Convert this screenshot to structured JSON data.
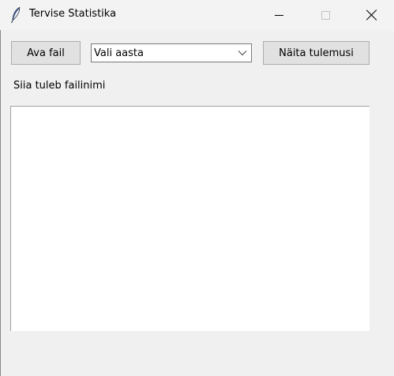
{
  "window": {
    "title": "Tervise Statistika",
    "app_icon": "feather-icon",
    "controls": [
      "minimize-icon",
      "maximize-icon",
      "close-icon"
    ]
  },
  "toolbar": {
    "open_file_label": "Ava fail",
    "year_select": {
      "selected": "Vali aasta"
    },
    "show_results_label": "Näita tulemusi"
  },
  "filename_label": "Siia tuleb failinimi",
  "results_text": ""
}
